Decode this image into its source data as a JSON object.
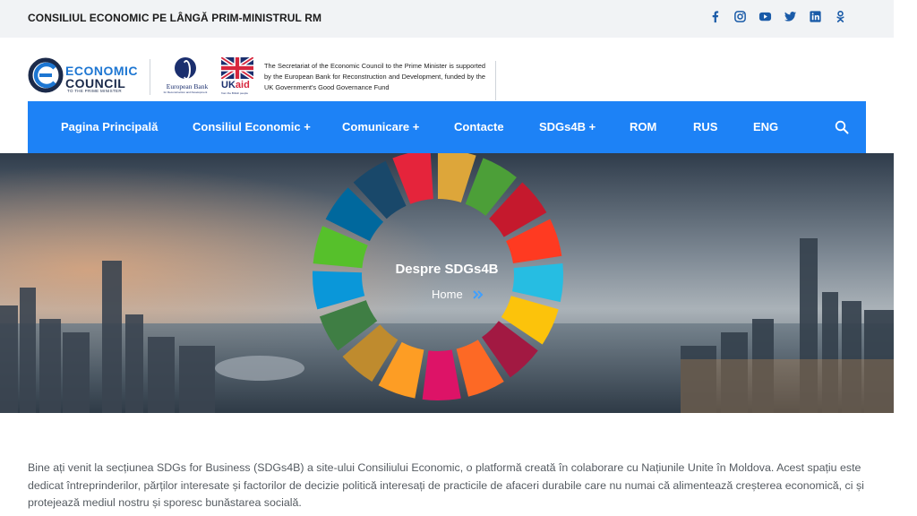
{
  "topbar": {
    "brand": "CONSILIUL ECONOMIC PE LÂNGĂ PRIM-MINISTRUL RM",
    "social_icons": [
      "facebook-icon",
      "instagram-icon",
      "youtube-icon",
      "twitter-icon",
      "linkedin-icon",
      "odnoklassniki-icon"
    ]
  },
  "logos": {
    "ec_line1": "ECONOMIC",
    "ec_line2": "COUNCIL",
    "ec_line3": "TO THE PRIME MINISTER",
    "ebrd_name": "European Bank",
    "ebrd_sub": "for Reconstruction and Development",
    "ukaid_uk": "UK",
    "ukaid_aid": "aid",
    "ukaid_tag": "from the British people",
    "secretariat_text": "The Secretariat of the Economic Council to the Prime Minister is supported by the European Bank for Reconstruction and Development, funded by the UK Government's Good Governance Fund"
  },
  "nav": {
    "items": [
      "Pagina Principală",
      "Consiliul Economic +",
      "Comunicare +",
      "Contacte",
      "SDGs4B +",
      "ROM",
      "RUS",
      "ENG"
    ],
    "accent": "#1d82f6"
  },
  "hero": {
    "title": "Despre SDGs4B",
    "breadcrumb": "Home",
    "sdg_colors": [
      "#e5243b",
      "#dda63a",
      "#4c9f38",
      "#c5192d",
      "#ff3a21",
      "#26bde2",
      "#fcc30b",
      "#a21942",
      "#fd6925",
      "#dd1367",
      "#fd9d24",
      "#bf8b2e",
      "#3f7e44",
      "#0a97d9",
      "#56c02b",
      "#00689d",
      "#19486a"
    ]
  },
  "content": {
    "intro": "Bine ați venit la secțiunea SDGs for Business (SDGs4B) a site-ului Consiliului Economic, o platformă creată în colaborare cu Națiunile Unite în Moldova. Acest spațiu este dedicat întreprinderilor, părților interesate și factorilor de decizie politică interesați de practicile de afaceri durabile care nu numai că alimentează creșterea economică, ci și protejează mediul nostru și sporesc bunăstarea socială."
  }
}
